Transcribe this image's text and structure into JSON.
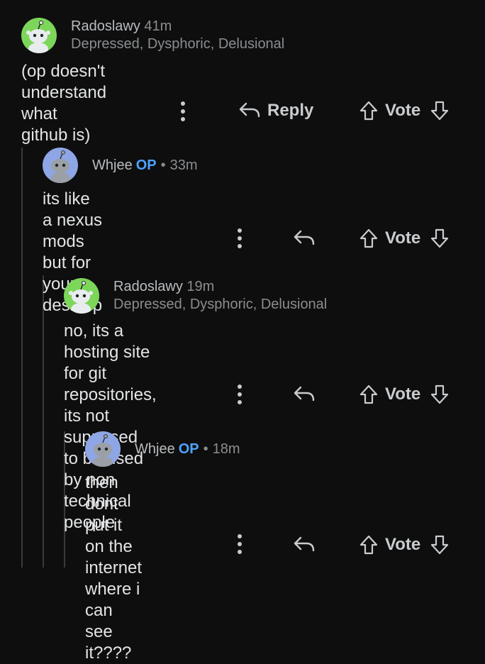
{
  "colors": {
    "background": "#0e0e0e",
    "op_badge": "#4fa3ff",
    "avatar_green": "#7cd65a",
    "avatar_blue": "#8ea6e6"
  },
  "comments": [
    {
      "username": "Radoslawy",
      "time": "41m",
      "flair": "Depressed, Dysphoric, Delusional",
      "body": "(op doesn't understand what github is)",
      "reply_label": "Reply",
      "vote_label": "Vote",
      "avatar_icon": "snoo-avatar-icon"
    },
    {
      "username": "Whjee",
      "op_badge": "OP",
      "separator": "•",
      "time": "33m",
      "body": "its like a nexus mods but for your desktop",
      "vote_label": "Vote",
      "avatar_icon": "snoo-avatar-icon"
    },
    {
      "username": "Radoslawy",
      "time": "19m",
      "flair": "Depressed, Dysphoric, Delusional",
      "body": "no, its a hosting site for git repositories, its not\nsupposed to be used by non technical people",
      "vote_label": "Vote",
      "avatar_icon": "snoo-avatar-icon"
    },
    {
      "username": "Whjee",
      "op_badge": "OP",
      "separator": "•",
      "time": "18m",
      "body": "then dont put it on the internet where i can\nsee it????",
      "vote_label": "Vote",
      "avatar_icon": "snoo-avatar-icon"
    }
  ]
}
